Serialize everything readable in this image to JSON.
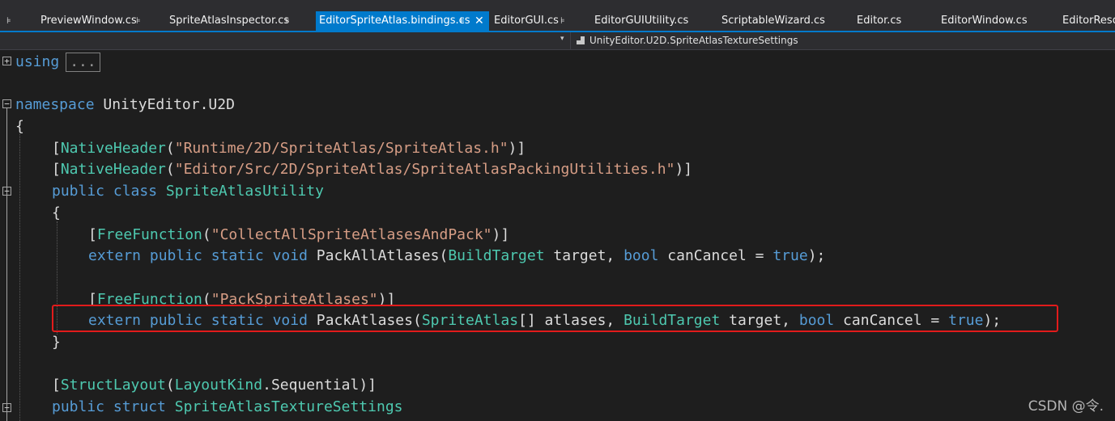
{
  "tabs": [
    {
      "label": "PreviewWindow.cs",
      "pinned": true,
      "active": false
    },
    {
      "label": "SpriteAtlasInspector.cs",
      "pinned": true,
      "active": false
    },
    {
      "label": "EditorSpriteAtlas.bindings.cs",
      "pinned": true,
      "active": true
    },
    {
      "label": "EditorGUI.cs",
      "pinned": true,
      "active": false
    },
    {
      "label": "EditorGUIUtility.cs",
      "pinned": false,
      "active": false
    },
    {
      "label": "ScriptableWizard.cs",
      "pinned": false,
      "active": false
    },
    {
      "label": "Editor.cs",
      "pinned": false,
      "active": false
    },
    {
      "label": "EditorWindow.cs",
      "pinned": false,
      "active": false
    },
    {
      "label": "EditorReso",
      "pinned": false,
      "active": false
    }
  ],
  "navbar": {
    "member": "UnityEditor.U2D.SpriteAtlasTextureSettings"
  },
  "code": {
    "l1_using": "using",
    "l1_collapsed": "...",
    "l3_kw": "namespace",
    "l3_name": " UnityEditor.U2D",
    "l4": "{",
    "l5_a": "[",
    "l5_attr": "NativeHeader",
    "l5_b": "(",
    "l5_str": "\"Runtime/2D/SpriteAtlas/SpriteAtlas.h\"",
    "l5_c": ")]",
    "l6_a": "[",
    "l6_attr": "NativeHeader",
    "l6_b": "(",
    "l6_str": "\"Editor/Src/2D/SpriteAtlas/SpriteAtlasPackingUtilities.h\"",
    "l6_c": ")]",
    "l7_kw": "public class",
    "l7_type": "SpriteAtlasUtility",
    "l8": "{",
    "l9_a": "[",
    "l9_attr": "FreeFunction",
    "l9_b": "(",
    "l9_str": "\"CollectAllSpriteAtlasesAndPack\"",
    "l9_c": ")]",
    "l10_kw": "extern public static void",
    "l10_name": " PackAllAtlases(",
    "l10_t1": "BuildTarget",
    "l10_p1": " target, ",
    "l10_t2": "bool",
    "l10_p2": " canCancel = ",
    "l10_true": "true",
    "l10_end": ");",
    "l12_a": "[",
    "l12_attr": "FreeFunction",
    "l12_b": "(",
    "l12_str": "\"PackSpriteAtlases\"",
    "l12_c": ")]",
    "l13_kw": "extern public static void",
    "l13_name": " PackAtlases(",
    "l13_t1": "SpriteAtlas",
    "l13_p1": "[] atlases, ",
    "l13_t2": "BuildTarget",
    "l13_p2": " target, ",
    "l13_t3": "bool",
    "l13_p3": " canCancel = ",
    "l13_true": "true",
    "l13_end": ");",
    "l14": "}",
    "l16_a": "[",
    "l16_attr": "StructLayout",
    "l16_b": "(",
    "l16_type": "LayoutKind",
    "l16_c": ".Sequential)]",
    "l17_kw": "public struct",
    "l17_type": "SpriteAtlasTextureSettings"
  },
  "watermark": "CSDN @令."
}
